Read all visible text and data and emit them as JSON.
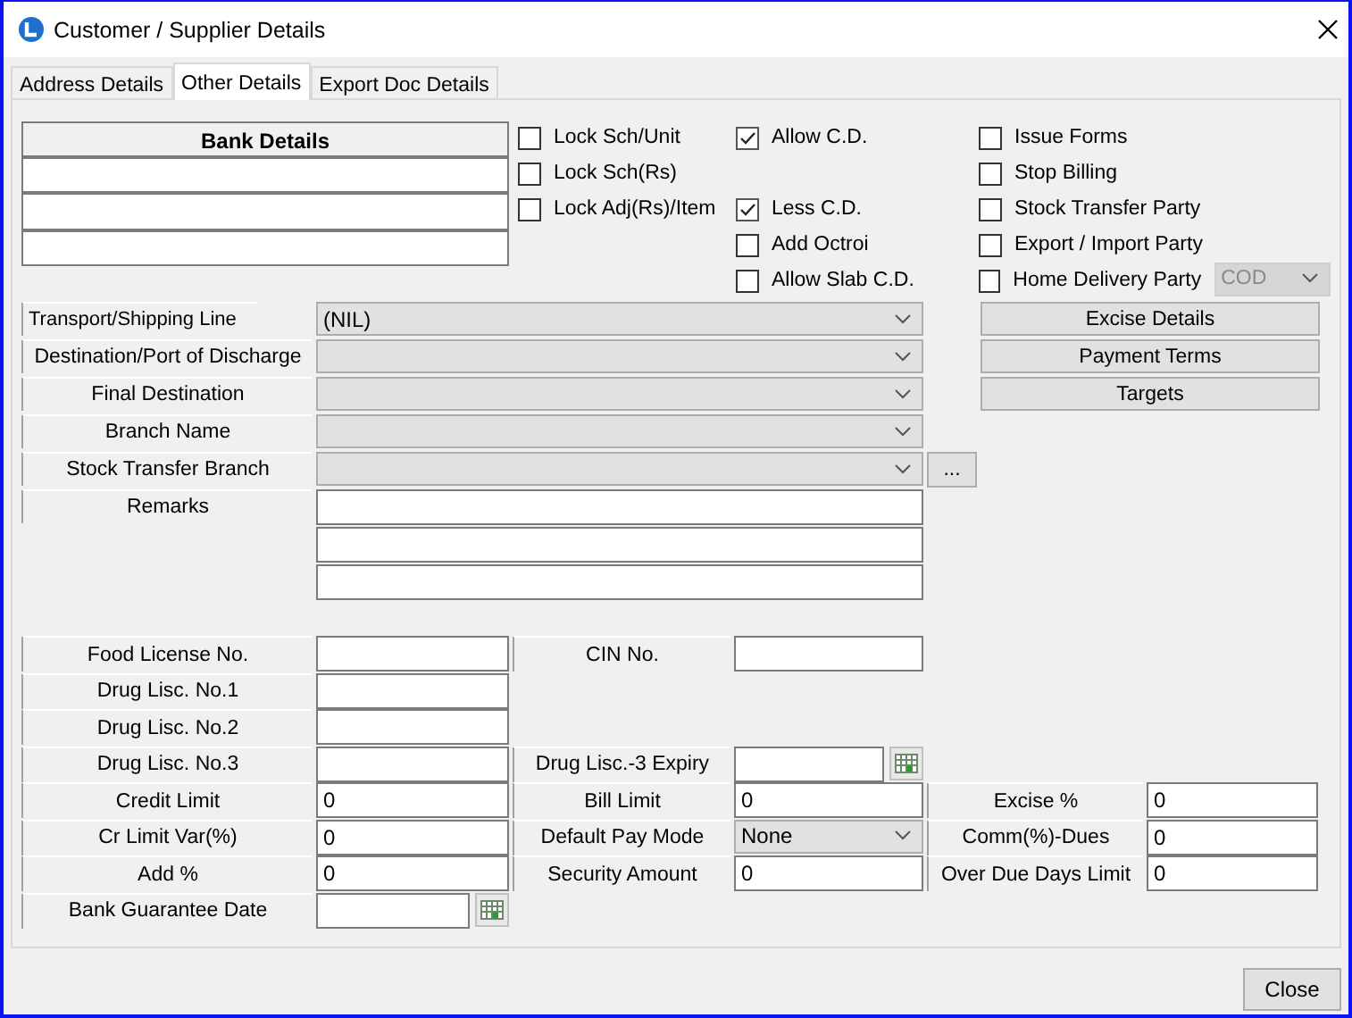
{
  "window": {
    "title": "Customer / Supplier Details"
  },
  "tabs": [
    {
      "label": "Address Details",
      "selected": false
    },
    {
      "label": "Other Details",
      "selected": true
    },
    {
      "label": "Export Doc Details",
      "selected": false
    }
  ],
  "bank_details": {
    "header": "Bank Details"
  },
  "checkbox_columns": [
    [
      {
        "label": "Lock Sch/Unit",
        "checked": false
      },
      {
        "label": "Lock Sch(Rs)",
        "checked": false
      },
      {
        "label": "Lock Adj(Rs)/Item",
        "checked": false
      }
    ],
    [
      {
        "label": "Allow C.D.",
        "checked": true
      },
      {
        "label": "Less C.D.",
        "checked": true
      },
      {
        "label": "Add Octroi",
        "checked": false
      },
      {
        "label": "Allow Slab C.D.",
        "checked": false
      }
    ],
    [
      {
        "label": "Issue Forms",
        "checked": false
      },
      {
        "label": "Stop Billing",
        "checked": false
      },
      {
        "label": "Stock Transfer Party",
        "checked": false
      },
      {
        "label": "Export / Import Party",
        "checked": false
      },
      {
        "label": "Home Delivery Party",
        "checked": false,
        "dropdown": {
          "value": "COD",
          "disabled": true
        }
      }
    ]
  ],
  "link_fields": [
    {
      "label": "Transport/Shipping Line",
      "value": "(NIL)"
    },
    {
      "label": "Destination/Port of Discharge"
    },
    {
      "label": "Final Destination"
    },
    {
      "label": "Branch Name"
    },
    {
      "label": "Stock Transfer Branch",
      "browse_button": "..."
    }
  ],
  "remarks": {
    "label": "Remarks"
  },
  "side_buttons": [
    "Excise Details",
    "Payment Terms",
    "Targets"
  ],
  "detail_rows": [
    [
      {
        "label": "Food License No.",
        "kind": "text"
      },
      {
        "label": "CIN No.",
        "kind": "text"
      }
    ],
    [
      {
        "label": "Drug Lisc. No.1",
        "kind": "text"
      }
    ],
    [
      {
        "label": "Drug Lisc. No.2",
        "kind": "text"
      }
    ],
    [
      {
        "label": "Drug Lisc. No.3",
        "kind": "text"
      },
      {
        "label": "Drug Lisc.-3 Expiry",
        "kind": "date"
      }
    ],
    [
      {
        "label": "Credit Limit",
        "kind": "text",
        "value": "0"
      },
      {
        "label": "Bill Limit",
        "kind": "text",
        "value": "0"
      },
      {
        "label": "Excise %",
        "kind": "text",
        "value": "0"
      }
    ],
    [
      {
        "label": "Cr Limit Var(%)",
        "kind": "text",
        "value": "0"
      },
      {
        "label": "Default Pay Mode",
        "kind": "combo",
        "value": "None"
      },
      {
        "label": "Comm(%)-Dues",
        "kind": "text",
        "value": "0"
      }
    ],
    [
      {
        "label": "Add %",
        "kind": "text",
        "value": "0"
      },
      {
        "label": "Security Amount",
        "kind": "text",
        "value": "0"
      },
      {
        "label": "Over Due Days Limit",
        "kind": "text",
        "value": "0"
      }
    ],
    [
      {
        "label": "Bank Guarantee Date",
        "kind": "date"
      }
    ]
  ],
  "footer_button": "Close"
}
